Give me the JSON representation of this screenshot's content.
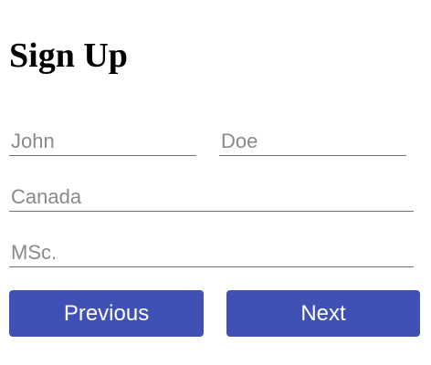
{
  "form": {
    "title": "Sign Up",
    "fields": {
      "first_name": {
        "value": "John"
      },
      "last_name": {
        "value": "Doe"
      },
      "country": {
        "value": "Canada"
      },
      "degree": {
        "value": "MSc."
      }
    },
    "buttons": {
      "previous_label": "Previous",
      "next_label": "Next"
    }
  },
  "colors": {
    "button_bg": "#3f51b5",
    "field_text": "#8a8a8a",
    "underline": "#6f6f6f"
  }
}
